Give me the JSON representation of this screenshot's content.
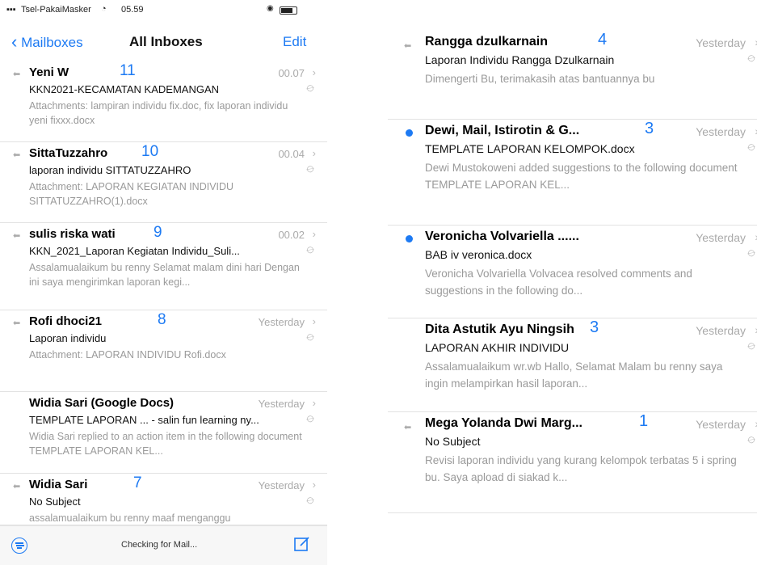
{
  "status_bar": {
    "carrier": "Tsel-PakaiMasker",
    "time": "05.59"
  },
  "nav": {
    "back_label": "Mailboxes",
    "title": "All Inboxes",
    "edit_label": "Edit"
  },
  "left_mails": [
    {
      "sender": "Yeni W",
      "count": "11",
      "date": "00.07",
      "subject": "KKN2021-KECAMATAN KADEMANGAN",
      "preview": "Attachments: lampiran individu fix.doc, fix laporan individu yeni fixxx.docx",
      "icon": "reply-arrow-icon"
    },
    {
      "sender": "SittaTuzzahro",
      "count": "10",
      "date": "00.04",
      "subject": "laporan individu SITTATUZZAHRO",
      "preview": "Attachment: LAPORAN KEGIATAN INDIVIDU SITTATUZZAHRO(1).docx",
      "icon": "reply-arrow-icon"
    },
    {
      "sender": "sulis riska wati",
      "count": "9",
      "date": "00.02",
      "subject": "KKN_2021_Laporan Kegiatan Individu_Suli...",
      "preview": "Assalamualaikum bu renny Selamat malam dini hari Dengan ini saya mengirimkan laporan kegi...",
      "icon": "reply-arrow-icon"
    },
    {
      "sender": "Rofi dhoci21",
      "count": "8",
      "date": "Yesterday",
      "subject": "Laporan individu",
      "preview": "Attachment: LAPORAN INDIVIDU Rofi.docx",
      "icon": "reply-arrow-icon"
    },
    {
      "sender": "Widia Sari (Google Docs)",
      "count": "",
      "date": "Yesterday",
      "subject": "TEMPLATE LAPORAN ... - salin fun learning ny...",
      "preview": "Widia Sari replied to an action item in the following document TEMPLATE LAPORAN KEL...",
      "icon": ""
    },
    {
      "sender": "Widia Sari",
      "count": "7",
      "date": "Yesterday",
      "subject": "No Subject",
      "preview": "assalamualaikum bu renny maaf menganggu",
      "icon": "reply-arrow-icon"
    }
  ],
  "toolbar": {
    "status": "Checking for Mail..."
  },
  "right_mails": [
    {
      "sender": "Rangga dzulkarnain",
      "count": "4",
      "date": "Yesterday",
      "subject": "Laporan Individu Rangga Dzulkarnain",
      "preview": "Dimengerti Bu, terimakasih atas bantuannya bu",
      "icon": "reply-arrow-icon"
    },
    {
      "sender": "Dewi, Mail, Istirotin & G...",
      "count": "3",
      "date": "Yesterday",
      "subject": "TEMPLATE LAPORAN KELOMPOK.docx",
      "preview": "Dewi Mustokoweni added suggestions to the following document TEMPLATE LAPORAN KEL...",
      "icon": "unread-dot-icon"
    },
    {
      "sender": "Veronicha Volvariella ......",
      "count": "",
      "date": "Yesterday",
      "subject": "BAB iv veronica.docx",
      "preview": "Veronicha Volvariella Volvacea resolved comments and suggestions in the following do...",
      "icon": "unread-dot-icon"
    },
    {
      "sender": "Dita Astutik Ayu Ningsih",
      "count": "3",
      "date": "Yesterday",
      "subject": "LAPORAN AKHIR INDIVIDU",
      "preview": "Assalamualaikum wr.wb Hallo, Selamat Malam bu renny saya ingin melampirkan hasil laporan...",
      "icon": ""
    },
    {
      "sender": "Mega Yolanda Dwi Marg...",
      "count": "1",
      "date": "Yesterday",
      "subject": "No Subject",
      "preview": "Revisi laporan individu yang kurang kelompok terbatas 5 i spring bu. Saya apload di siakad k...",
      "icon": "reply-arrow-icon"
    }
  ],
  "colors": {
    "accent": "#1d7af3",
    "muted_text": "#9a9a9a",
    "divider": "#e2e2e2"
  }
}
